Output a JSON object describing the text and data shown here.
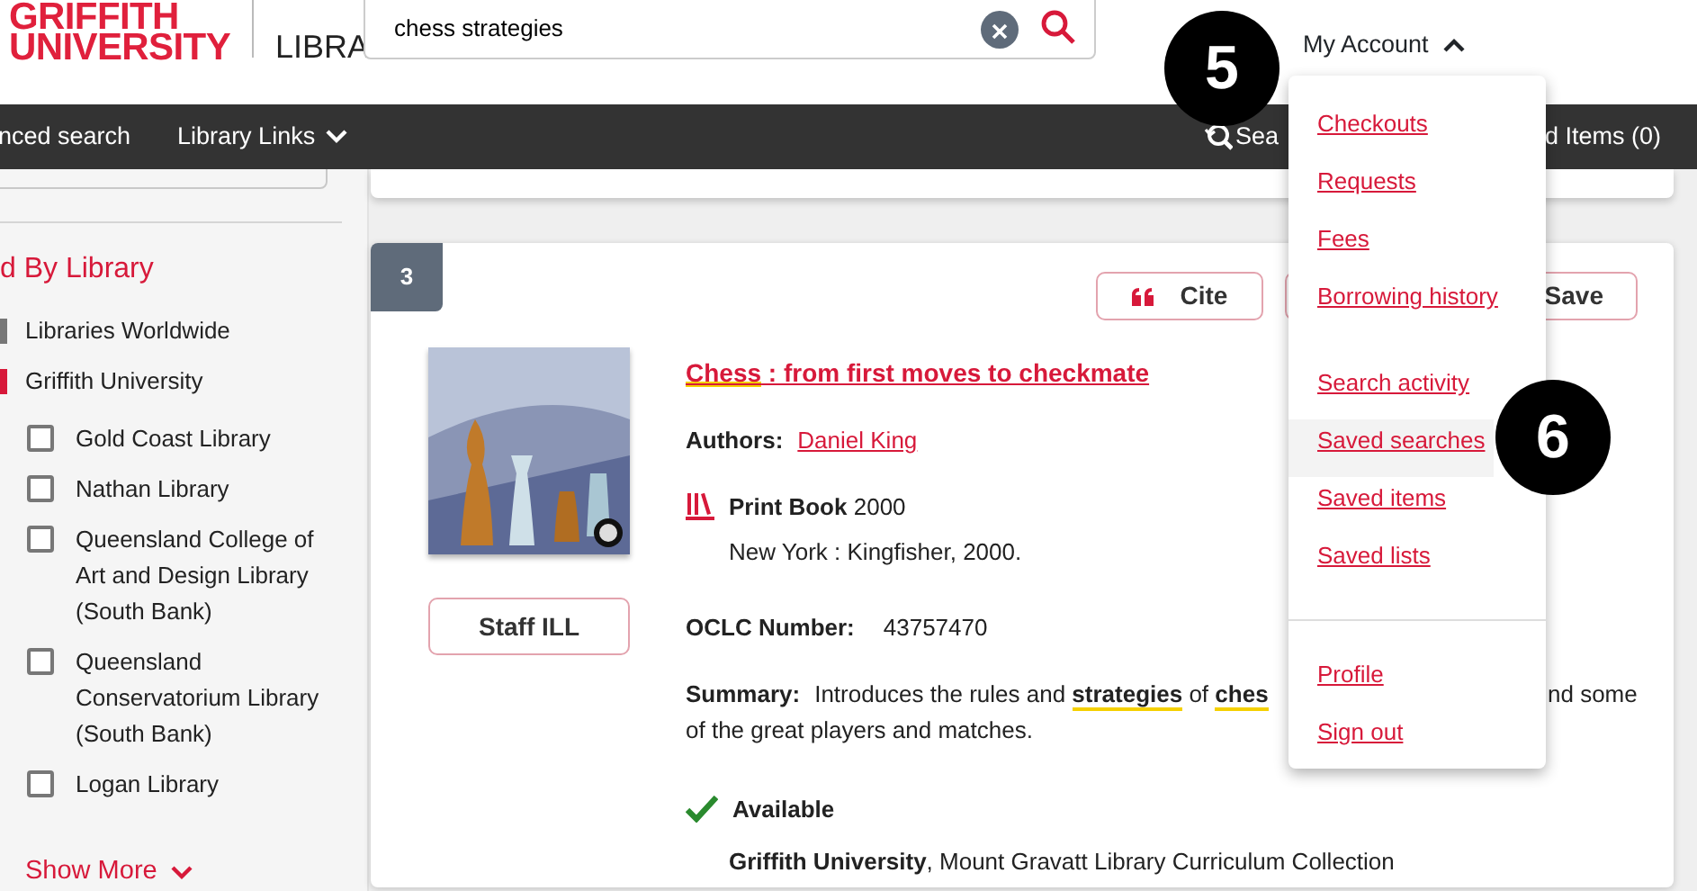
{
  "header": {
    "logo_line_1": "GRIFFITH",
    "logo_line_2": "UNIVERSITY",
    "site_name": "LIBRA",
    "search": {
      "value": "chess strategies"
    },
    "account": "My Account",
    "account_expanded": true
  },
  "navbar": {
    "left": [
      {
        "label": "nced search",
        "has_caret": false
      },
      {
        "label": "Library Links",
        "has_caret": true
      }
    ],
    "right": [
      {
        "label": "Sea",
        "kind": "history"
      },
      {
        "label": "d Items (0)",
        "kind": "plain"
      }
    ]
  },
  "sidebar": {
    "heading": "d By Library",
    "scopes": [
      {
        "label": "Libraries Worldwide",
        "selected": false
      },
      {
        "label": "Griffith University",
        "selected": true
      }
    ],
    "libraries": [
      {
        "label": "Gold Coast Library",
        "checked": false
      },
      {
        "label": "Nathan Library",
        "checked": false
      },
      {
        "label": "Queensland College of Art and Design Library (South Bank)",
        "checked": false
      },
      {
        "label": "Queensland Conservatorium Library (South Bank)",
        "checked": false
      },
      {
        "label": "Logan Library",
        "checked": false
      }
    ],
    "show_more": "Show More"
  },
  "result": {
    "number": "3",
    "actions": [
      {
        "label": "Cite",
        "kind": "cite"
      },
      {
        "label": "Save",
        "kind": "save"
      }
    ],
    "title": [
      {
        "text": "Chess",
        "highlighted": true
      },
      {
        "text": " : from first moves to checkmate",
        "highlighted": false
      }
    ],
    "authors_label": "Authors:",
    "author": "Daniel King",
    "format": "Print Book",
    "year": "2000",
    "publisher": "New York : Kingfisher, 2000.",
    "oclc_label": "OCLC Number:",
    "oclc": "43757470",
    "summary_label": "Summary:",
    "summary_line_1": [
      {
        "text": "Introduces the rules and ",
        "highlighted": false
      },
      {
        "text": "strategies",
        "highlighted": true
      },
      {
        "text": " of ",
        "highlighted": false
      },
      {
        "text": "ches",
        "highlighted": true
      }
    ],
    "summary_line_1_end": "nd some",
    "summary_line_2": "of the great players and matches.",
    "availability": "Available",
    "available": true,
    "holding": "**Griffith University**, Mount Gravatt Library Curriculum Collection",
    "staff_button": "Staff ILL"
  },
  "account_menu": {
    "groups": [
      [
        {
          "label": "Checkouts",
          "hovered": false
        },
        {
          "label": "Requests",
          "hovered": false
        },
        {
          "label": "Fees",
          "hovered": false
        },
        {
          "label": "Borrowing history",
          "hovered": false
        }
      ],
      [
        {
          "label": "Search activity",
          "hovered": false
        },
        {
          "label": "Saved searches",
          "hovered": true
        },
        {
          "label": "Saved items",
          "hovered": false
        },
        {
          "label": "Saved lists",
          "hovered": false
        }
      ],
      [
        {
          "label": "Profile",
          "hovered": false
        },
        {
          "label": "Sign out",
          "hovered": false
        }
      ]
    ]
  },
  "callouts": [
    {
      "label": "5"
    },
    {
      "label": "6"
    }
  ]
}
